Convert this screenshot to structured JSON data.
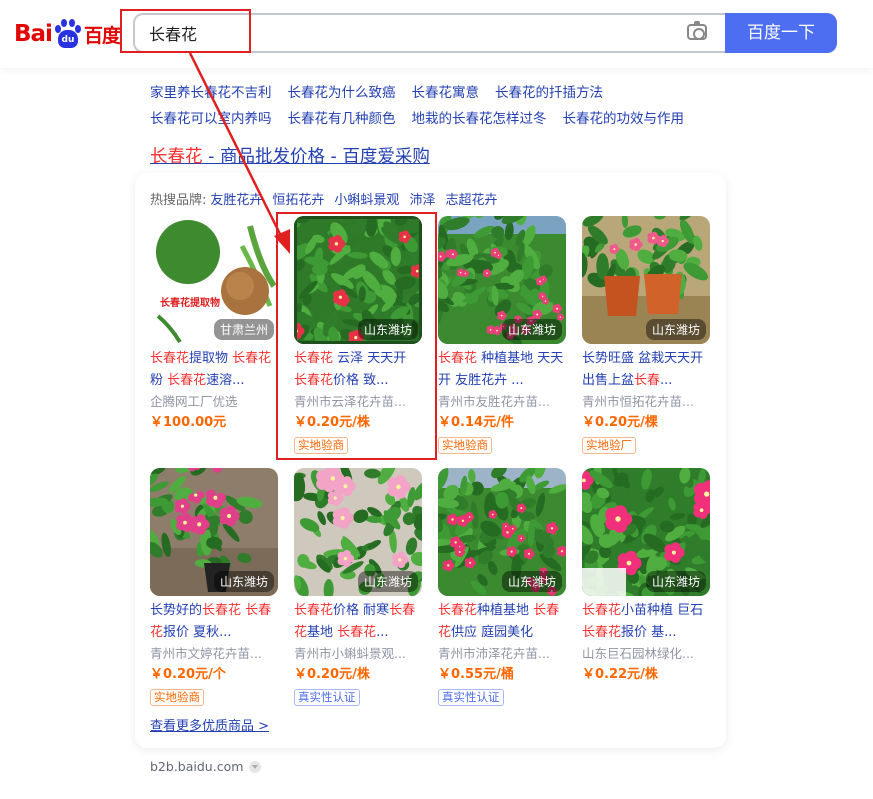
{
  "logo": {
    "text_left": "Bai",
    "text_paw": "du",
    "text_right": "百度"
  },
  "search": {
    "value": "长春花",
    "button_label": "百度一下"
  },
  "related": [
    [
      "家里养长春花不吉利",
      "长春花为什么致癌",
      "长春花寓意",
      "长春花的扦插方法"
    ],
    [
      "长春花可以室内养吗",
      "长春花有几种颜色",
      "地栽的长春花怎样过冬",
      "长春花的功效与作用"
    ]
  ],
  "result": {
    "title_hl": "长春花",
    "title_rest": " - 商品批发价格 - 百度爱采购"
  },
  "hot": {
    "label": "热搜品牌:",
    "brands": [
      "友胜花卉",
      "恒拓花卉",
      "小蝌蚪景观",
      "沛泽",
      "志超花卉"
    ]
  },
  "products": [
    {
      "title": [
        [
          "长春花",
          true
        ],
        [
          "提取物 ",
          false
        ],
        [
          "长春花",
          true
        ],
        [
          "粉 ",
          false
        ],
        [
          "长春花",
          true
        ],
        [
          "速溶...",
          false
        ]
      ],
      "seller": "企腾网工厂优选",
      "price": "￥100.00元",
      "tag": "",
      "tagc": "",
      "loc": "甘肃兰州",
      "img": "extract",
      "img_text": "长春花提取物"
    },
    {
      "title": [
        [
          "长春花",
          true
        ],
        [
          " 云泽 天天开 ",
          false
        ],
        [
          "长春花",
          true
        ],
        [
          "价格 致...",
          false
        ]
      ],
      "seller": "青州市云泽花卉苗...",
      "price": "￥0.20元/株",
      "tag": "实地验商",
      "tagc": "orange",
      "loc": "山东潍坊",
      "img": "green"
    },
    {
      "title": [
        [
          "长春花",
          true
        ],
        [
          " 种植基地 天天开 友胜花卉 ...",
          false
        ]
      ],
      "seller": "青州市友胜花卉苗...",
      "price": "￥0.14元/件",
      "tag": "实地验商",
      "tagc": "orange",
      "loc": "山东潍坊",
      "img": "field"
    },
    {
      "title": [
        [
          "长势旺盛 盆栽天天开 出售上盆",
          false
        ],
        [
          "长春",
          true
        ],
        [
          "...",
          false
        ]
      ],
      "seller": "青州市恒拓花卉苗...",
      "price": "￥0.20元/棵",
      "tag": "实地验厂",
      "tagc": "orange",
      "loc": "山东潍坊",
      "img": "pots"
    },
    {
      "title": [
        [
          "长势好的",
          false
        ],
        [
          "长春花 长春",
          true
        ],
        [
          "花",
          true
        ],
        [
          "报价 夏秋...",
          false
        ]
      ],
      "seller": "青州市文婷花卉苗...",
      "price": "￥0.20元/个",
      "tag": "实地验商",
      "tagc": "orange",
      "loc": "山东潍坊",
      "img": "soil"
    },
    {
      "title": [
        [
          "长春花",
          true
        ],
        [
          "价格 耐寒",
          false
        ],
        [
          "长春",
          true
        ],
        [
          "花",
          true
        ],
        [
          "基地 ",
          false
        ],
        [
          "长春花",
          true
        ],
        [
          "...",
          false
        ]
      ],
      "seller": "青州市小蝌蚪景观...",
      "price": "￥0.20元/株",
      "tag": "真实性认证",
      "tagc": "blue",
      "loc": "山东潍坊",
      "img": "pink"
    },
    {
      "title": [
        [
          "长春花",
          true
        ],
        [
          "种植基地 ",
          false
        ],
        [
          "长春",
          true
        ],
        [
          "花",
          true
        ],
        [
          "供应 庭园美化",
          false
        ]
      ],
      "seller": "青州市沛泽花卉苗...",
      "price": "￥0.55元/桶",
      "tag": "真实性认证",
      "tagc": "blue",
      "loc": "山东潍坊",
      "img": "rows"
    },
    {
      "title": [
        [
          "长春花",
          true
        ],
        [
          "小苗种植 巨石 ",
          false
        ],
        [
          "长春花",
          true
        ],
        [
          "报价 基...",
          false
        ]
      ],
      "seller": "山东巨石园林绿化...",
      "price": "￥0.22元/株",
      "tag": "",
      "tagc": "",
      "loc": "山东潍坊",
      "img": "close"
    }
  ],
  "more_label": "查看更多优质商品 >",
  "source": "b2b.baidu.com",
  "colors": {
    "accent": "#4e6ef2",
    "link": "#2440b3",
    "highlight": "#f73131",
    "price": "#ff6600",
    "annotation": "#e02020"
  }
}
